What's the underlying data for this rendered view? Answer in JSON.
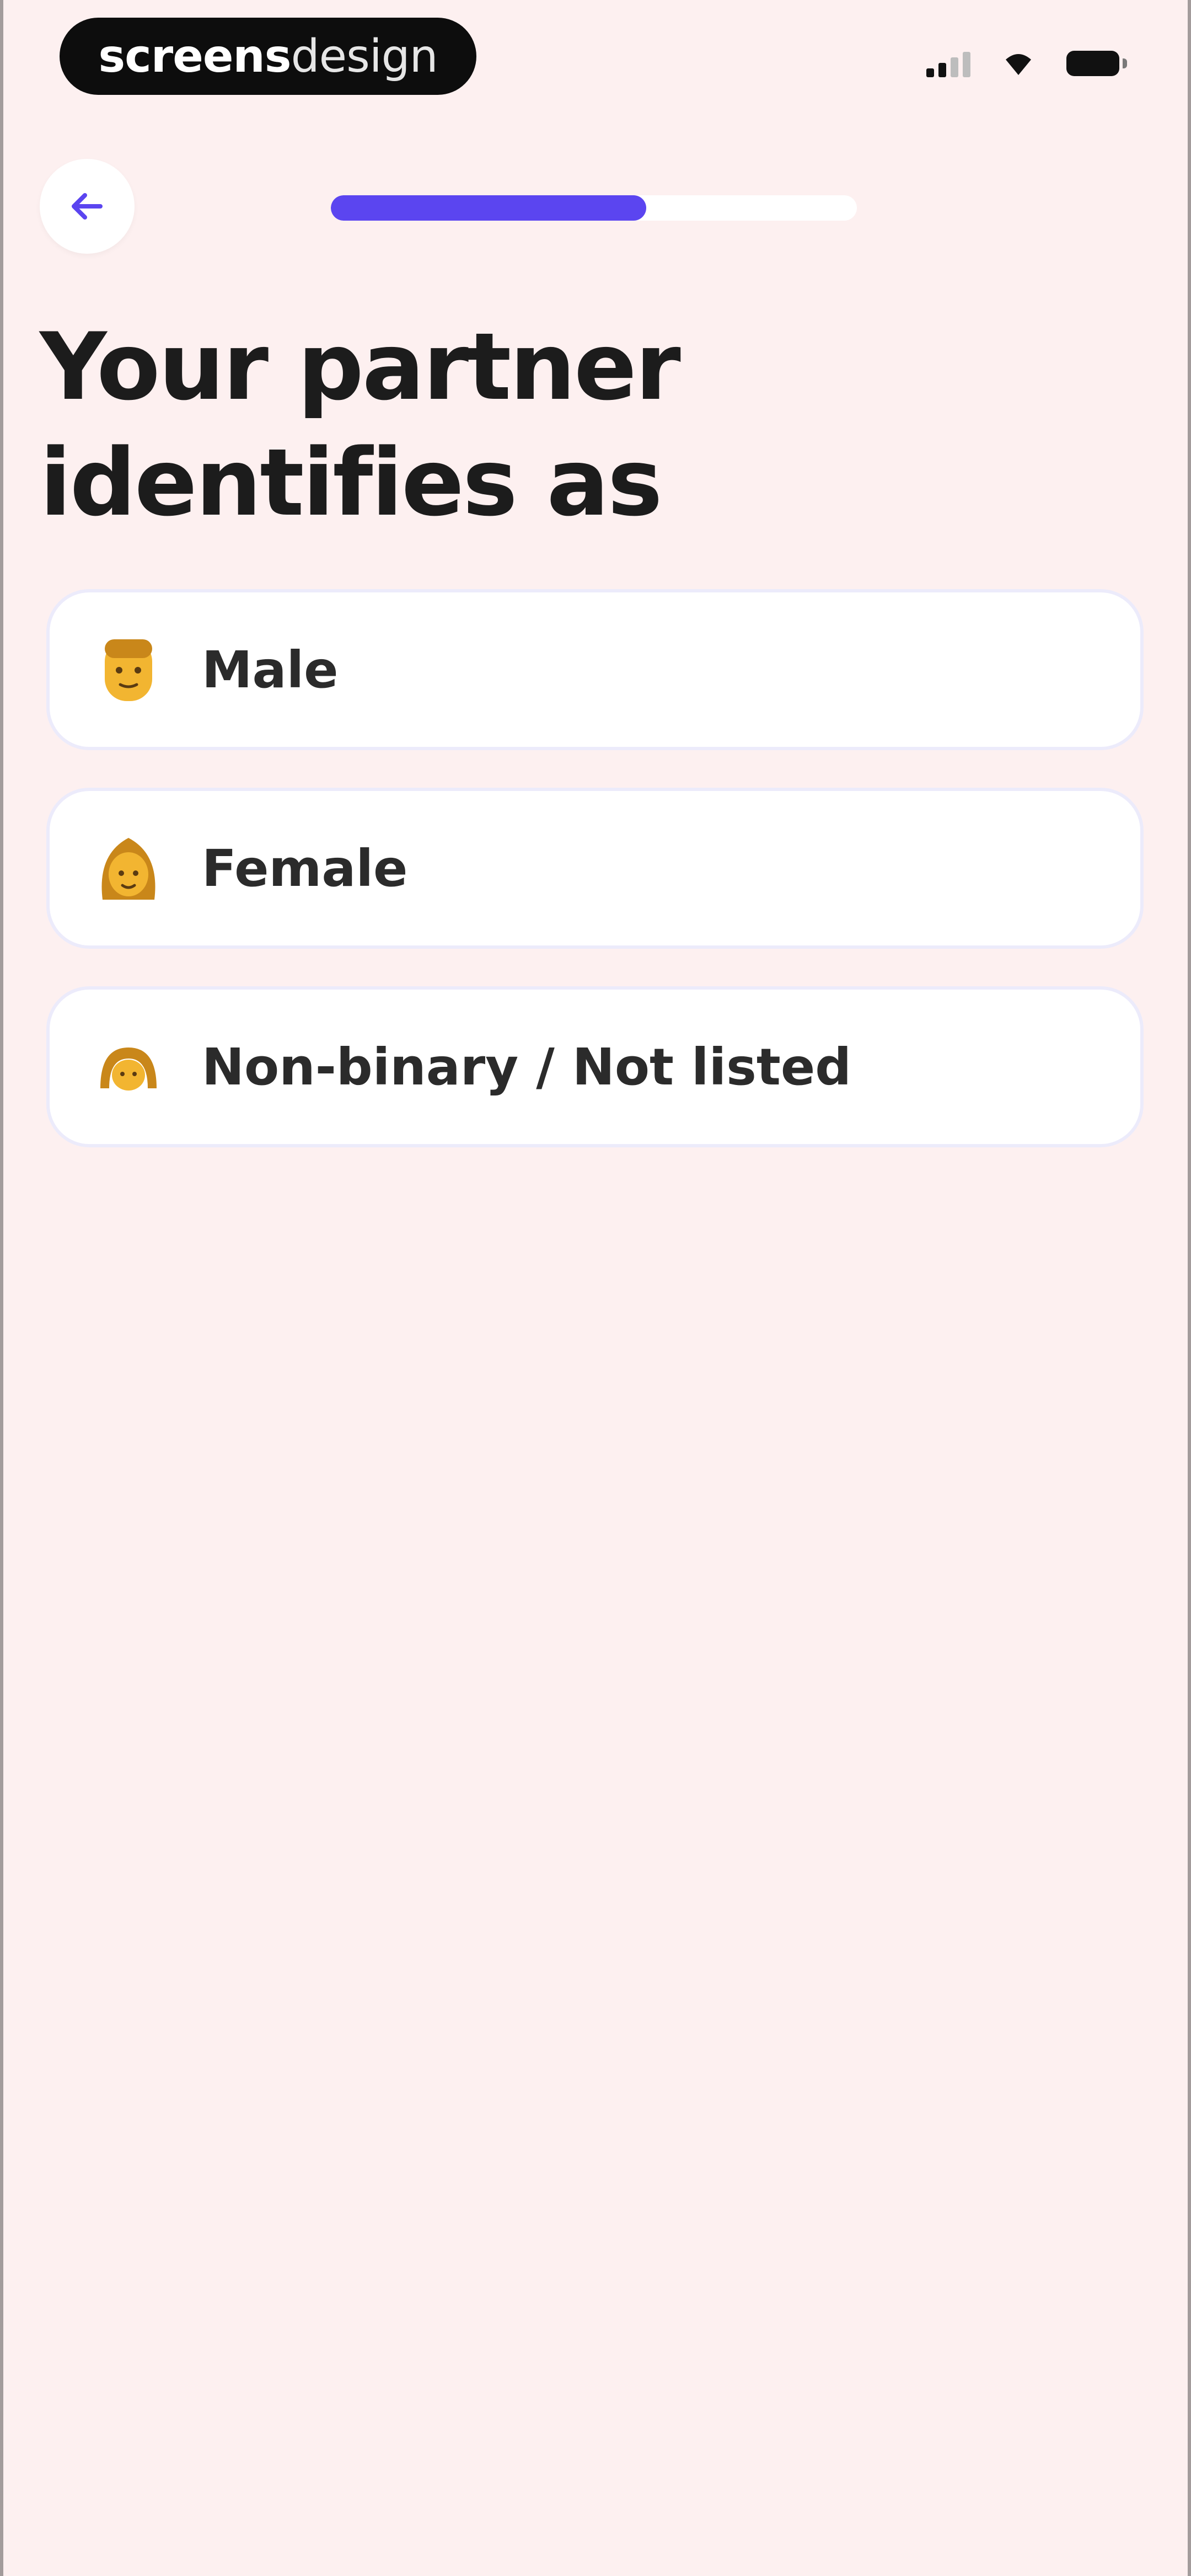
{
  "status_bar": {
    "brand_strong": "screens",
    "brand_light": "design",
    "icons": [
      "signal-icon",
      "wifi-icon",
      "battery-icon"
    ]
  },
  "header": {
    "back_icon": "arrow-left-icon",
    "progress": 0.6
  },
  "title": "Your partner identifies as",
  "options": [
    {
      "label": "Male",
      "icon": "man-face-icon"
    },
    {
      "label": "Female",
      "icon": "woman-face-icon"
    },
    {
      "label": "Non-binary / Not listed",
      "icon": "person-face-icon"
    }
  ],
  "colors": {
    "background": "#fdf0f0",
    "accent": "#5b45f0",
    "icon_yellow": "#f2b531",
    "card_border": "#ecebfb"
  }
}
